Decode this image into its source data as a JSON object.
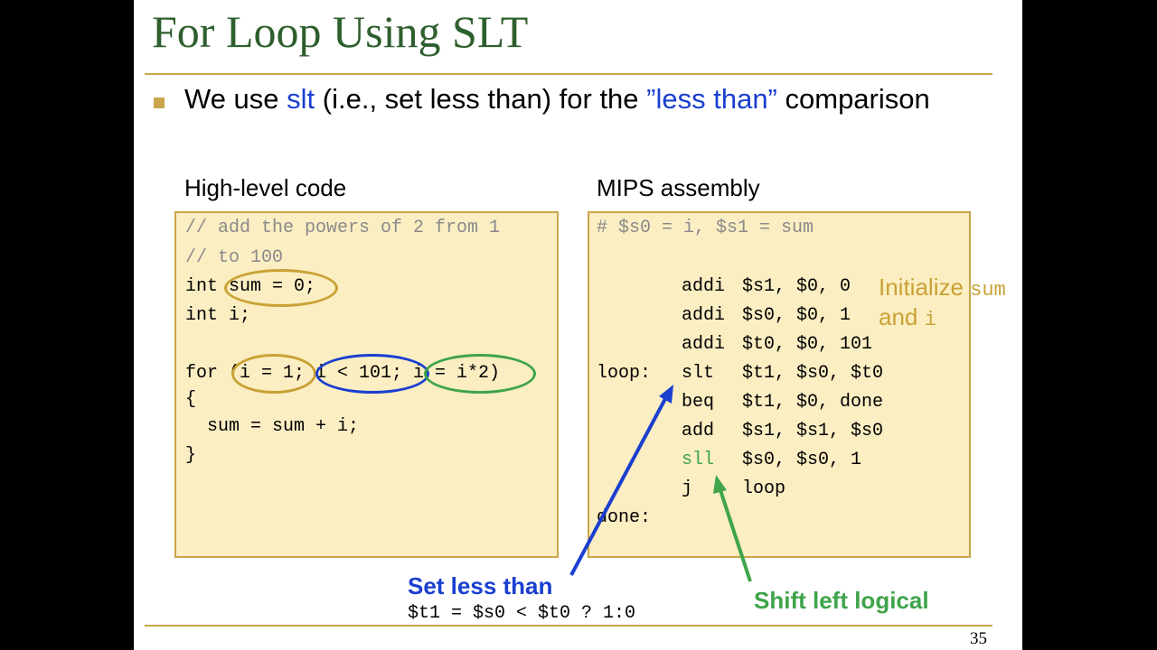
{
  "slide": {
    "title": "For Loop Using SLT",
    "page_number": "35",
    "bullet": {
      "pre": "We use ",
      "kw": "slt",
      "mid": " (i.e., set less than) for the ",
      "quoted": "”less than”",
      "post": " comparison"
    },
    "high_level": {
      "label": "High-level code",
      "lines": [
        "// add the powers of 2 from 1",
        "// to 100",
        "int sum = 0;",
        "int i;",
        "",
        "for (i = 1; i < 101; i = i*2)",
        "{",
        "  sum = sum + i;",
        "}"
      ]
    },
    "assembly": {
      "label": "MIPS assembly",
      "comment": "# $s0 = i, $s1 = sum",
      "rows": [
        {
          "label": "",
          "op": "addi",
          "args": "$s1, $0, 0"
        },
        {
          "label": "",
          "op": "addi",
          "args": "$s0, $0, 1"
        },
        {
          "label": "",
          "op": "addi",
          "args": "$t0, $0, 101"
        },
        {
          "label": "loop:",
          "op": "slt",
          "args": "$t1, $s0, $t0"
        },
        {
          "label": "",
          "op": "beq",
          "args": "$t1, $0, done"
        },
        {
          "label": "",
          "op": "add",
          "args": "$s1, $s1, $s0"
        },
        {
          "label": "",
          "op": "sll",
          "args": "$s0, $s0, 1"
        },
        {
          "label": "",
          "op": "j",
          "args": "loop"
        },
        {
          "label": "done:",
          "op": "",
          "args": ""
        }
      ]
    },
    "annotations": {
      "init_line1_text": "Initialize ",
      "init_line1_code": "sum",
      "init_line2_text": "and ",
      "init_line2_code": "i",
      "slt_title": "Set less than",
      "slt_formula": "$t1 = $s0 < $t0 ? 1:0",
      "sll_title": "Shift left logical"
    }
  },
  "colors": {
    "title_green": "#2e5f2e",
    "accent_gold": "#c9a649",
    "box_fill": "#fbeec3",
    "blue": "#1a3fcf",
    "green": "#3fa44a"
  }
}
